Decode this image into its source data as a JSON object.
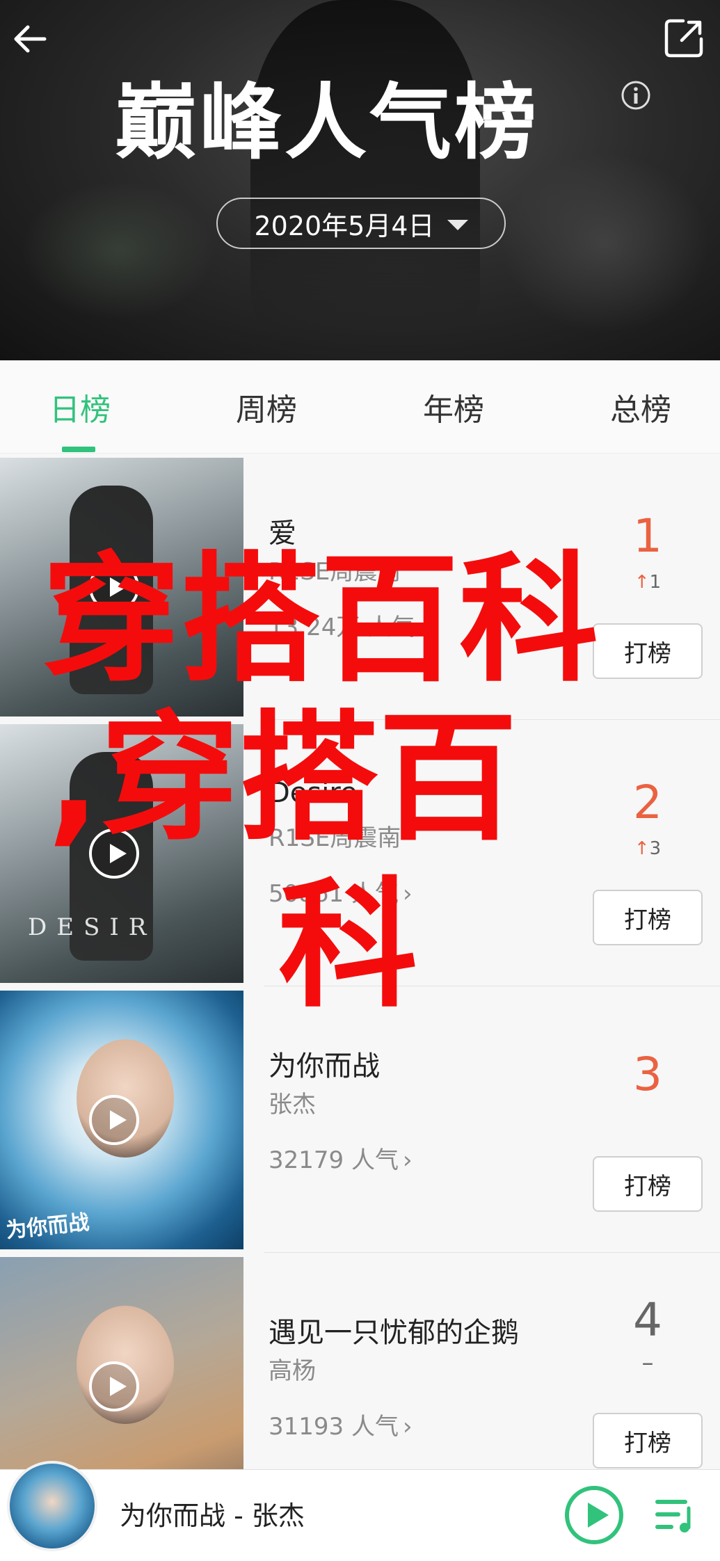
{
  "header": {
    "title": "巅峰人气榜",
    "date": "2020年5月4日"
  },
  "tabs": [
    {
      "label": "日榜",
      "active": true
    },
    {
      "label": "周榜",
      "active": false
    },
    {
      "label": "年榜",
      "active": false
    },
    {
      "label": "总榜",
      "active": false
    }
  ],
  "songs": [
    {
      "title": "爱",
      "artist": "R1SE周震南",
      "popularity": "13.24万 人气",
      "rank": "1",
      "rank_change": "1",
      "vote_label": "打榜"
    },
    {
      "title": "Desire",
      "artist": "R1SE周震南",
      "popularity": "50861 人气",
      "rank": "2",
      "rank_change": "3",
      "vote_label": "打榜"
    },
    {
      "title": "为你而战",
      "artist": "张杰",
      "popularity": "32179 人气",
      "rank": "3",
      "rank_change": "",
      "vote_label": "打榜"
    },
    {
      "title": "遇见一只忧郁的企鹅",
      "artist": "高杨",
      "popularity": "31193 人气",
      "rank": "4",
      "rank_change": "–",
      "vote_label": "打榜"
    }
  ],
  "covers": {
    "cover_3_caption": "为你而战",
    "cover_2_word": "DESIR"
  },
  "watermark": {
    "line1": "穿搭百科",
    "line2": ",穿搭百",
    "line3": "科"
  },
  "player": {
    "now_playing": "为你而战 - 张杰"
  },
  "colors": {
    "accent_green": "#31c27c",
    "rank_red": "#ea6241",
    "watermark_red": "#f40c0c"
  }
}
